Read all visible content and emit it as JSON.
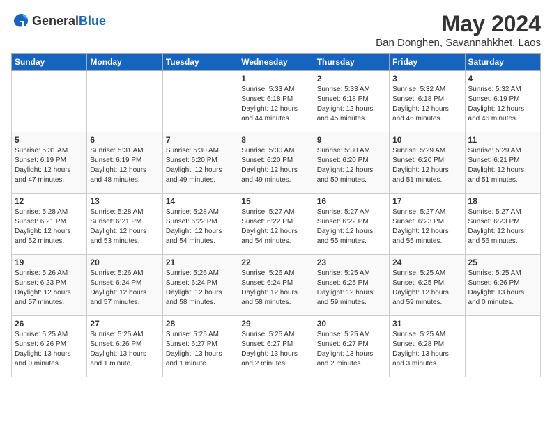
{
  "header": {
    "logo_general": "General",
    "logo_blue": "Blue",
    "month": "May 2024",
    "location": "Ban Donghen, Savannahkhet, Laos"
  },
  "days_of_week": [
    "Sunday",
    "Monday",
    "Tuesday",
    "Wednesday",
    "Thursday",
    "Friday",
    "Saturday"
  ],
  "weeks": [
    [
      {
        "day": "",
        "info": ""
      },
      {
        "day": "",
        "info": ""
      },
      {
        "day": "",
        "info": ""
      },
      {
        "day": "1",
        "info": "Sunrise: 5:33 AM\nSunset: 6:18 PM\nDaylight: 12 hours\nand 44 minutes."
      },
      {
        "day": "2",
        "info": "Sunrise: 5:33 AM\nSunset: 6:18 PM\nDaylight: 12 hours\nand 45 minutes."
      },
      {
        "day": "3",
        "info": "Sunrise: 5:32 AM\nSunset: 6:18 PM\nDaylight: 12 hours\nand 46 minutes."
      },
      {
        "day": "4",
        "info": "Sunrise: 5:32 AM\nSunset: 6:19 PM\nDaylight: 12 hours\nand 46 minutes."
      }
    ],
    [
      {
        "day": "5",
        "info": "Sunrise: 5:31 AM\nSunset: 6:19 PM\nDaylight: 12 hours\nand 47 minutes."
      },
      {
        "day": "6",
        "info": "Sunrise: 5:31 AM\nSunset: 6:19 PM\nDaylight: 12 hours\nand 48 minutes."
      },
      {
        "day": "7",
        "info": "Sunrise: 5:30 AM\nSunset: 6:20 PM\nDaylight: 12 hours\nand 49 minutes."
      },
      {
        "day": "8",
        "info": "Sunrise: 5:30 AM\nSunset: 6:20 PM\nDaylight: 12 hours\nand 49 minutes."
      },
      {
        "day": "9",
        "info": "Sunrise: 5:30 AM\nSunset: 6:20 PM\nDaylight: 12 hours\nand 50 minutes."
      },
      {
        "day": "10",
        "info": "Sunrise: 5:29 AM\nSunset: 6:20 PM\nDaylight: 12 hours\nand 51 minutes."
      },
      {
        "day": "11",
        "info": "Sunrise: 5:29 AM\nSunset: 6:21 PM\nDaylight: 12 hours\nand 51 minutes."
      }
    ],
    [
      {
        "day": "12",
        "info": "Sunrise: 5:28 AM\nSunset: 6:21 PM\nDaylight: 12 hours\nand 52 minutes."
      },
      {
        "day": "13",
        "info": "Sunrise: 5:28 AM\nSunset: 6:21 PM\nDaylight: 12 hours\nand 53 minutes."
      },
      {
        "day": "14",
        "info": "Sunrise: 5:28 AM\nSunset: 6:22 PM\nDaylight: 12 hours\nand 54 minutes."
      },
      {
        "day": "15",
        "info": "Sunrise: 5:27 AM\nSunset: 6:22 PM\nDaylight: 12 hours\nand 54 minutes."
      },
      {
        "day": "16",
        "info": "Sunrise: 5:27 AM\nSunset: 6:22 PM\nDaylight: 12 hours\nand 55 minutes."
      },
      {
        "day": "17",
        "info": "Sunrise: 5:27 AM\nSunset: 6:23 PM\nDaylight: 12 hours\nand 55 minutes."
      },
      {
        "day": "18",
        "info": "Sunrise: 5:27 AM\nSunset: 6:23 PM\nDaylight: 12 hours\nand 56 minutes."
      }
    ],
    [
      {
        "day": "19",
        "info": "Sunrise: 5:26 AM\nSunset: 6:23 PM\nDaylight: 12 hours\nand 57 minutes."
      },
      {
        "day": "20",
        "info": "Sunrise: 5:26 AM\nSunset: 6:24 PM\nDaylight: 12 hours\nand 57 minutes."
      },
      {
        "day": "21",
        "info": "Sunrise: 5:26 AM\nSunset: 6:24 PM\nDaylight: 12 hours\nand 58 minutes."
      },
      {
        "day": "22",
        "info": "Sunrise: 5:26 AM\nSunset: 6:24 PM\nDaylight: 12 hours\nand 58 minutes."
      },
      {
        "day": "23",
        "info": "Sunrise: 5:25 AM\nSunset: 6:25 PM\nDaylight: 12 hours\nand 59 minutes."
      },
      {
        "day": "24",
        "info": "Sunrise: 5:25 AM\nSunset: 6:25 PM\nDaylight: 12 hours\nand 59 minutes."
      },
      {
        "day": "25",
        "info": "Sunrise: 5:25 AM\nSunset: 6:26 PM\nDaylight: 13 hours\nand 0 minutes."
      }
    ],
    [
      {
        "day": "26",
        "info": "Sunrise: 5:25 AM\nSunset: 6:26 PM\nDaylight: 13 hours\nand 0 minutes."
      },
      {
        "day": "27",
        "info": "Sunrise: 5:25 AM\nSunset: 6:26 PM\nDaylight: 13 hours\nand 1 minute."
      },
      {
        "day": "28",
        "info": "Sunrise: 5:25 AM\nSunset: 6:27 PM\nDaylight: 13 hours\nand 1 minute."
      },
      {
        "day": "29",
        "info": "Sunrise: 5:25 AM\nSunset: 6:27 PM\nDaylight: 13 hours\nand 2 minutes."
      },
      {
        "day": "30",
        "info": "Sunrise: 5:25 AM\nSunset: 6:27 PM\nDaylight: 13 hours\nand 2 minutes."
      },
      {
        "day": "31",
        "info": "Sunrise: 5:25 AM\nSunset: 6:28 PM\nDaylight: 13 hours\nand 3 minutes."
      },
      {
        "day": "",
        "info": ""
      }
    ]
  ]
}
